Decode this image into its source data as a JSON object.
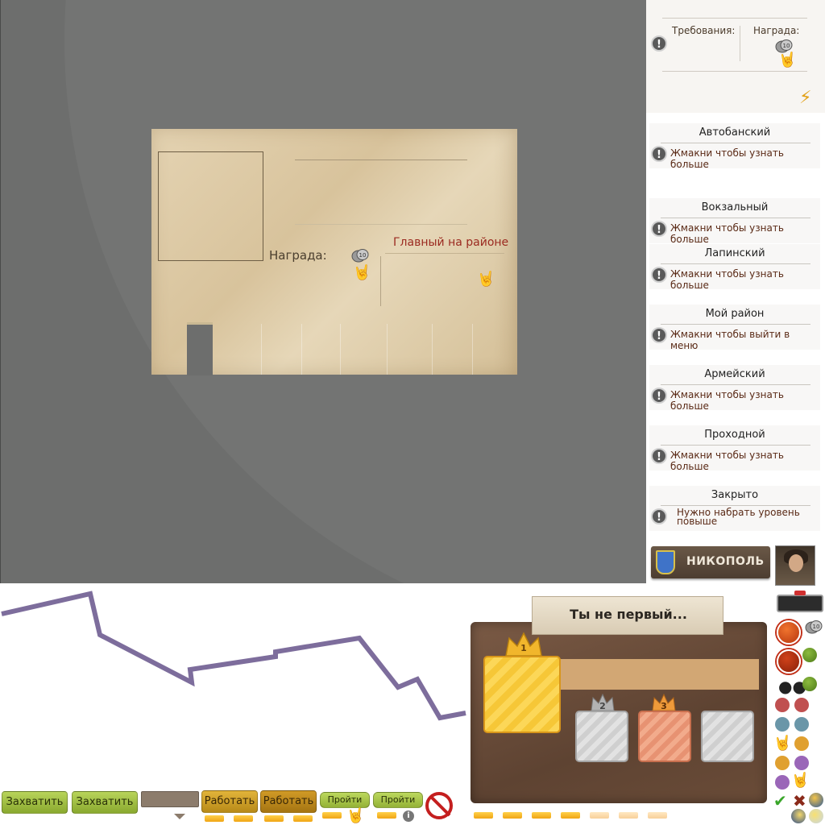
{
  "note": {
    "reward_label": "Награда:",
    "reward_title": "Главный на районе"
  },
  "requirements": {
    "requirements_label": "Требования:",
    "reward_label": "Награда:"
  },
  "districts": [
    {
      "name": "Автобанский",
      "desc": "Жмакни чтобы узнать больше"
    },
    {
      "name": "Вокзальный",
      "desc": "Жмакни чтобы узнать больше"
    },
    {
      "name": "Лапинский",
      "desc": "Жмакни чтобы узнать больше"
    },
    {
      "name": "Мой район",
      "desc": "Жмакни чтобы выйти в меню"
    },
    {
      "name": "Армейский",
      "desc": "Жмакни чтобы узнать больше"
    },
    {
      "name": "Проходной",
      "desc": "Жмакни чтобы узнать больше"
    },
    {
      "name": "Закрыто",
      "desc": "Нужно набрать уровень повыше"
    }
  ],
  "city": {
    "name": "НИКОПОЛЬ"
  },
  "podium": {
    "title": "Ты не первый...",
    "ranks": [
      "1",
      "2",
      "3"
    ]
  },
  "buttons": {
    "capture_1": "Захватить",
    "capture_2": "Захватить",
    "work_1": "Работать",
    "work_2": "Работать",
    "pass_1": "Пройти",
    "pass_2": "Пройти"
  },
  "colors": {
    "viewport_bg": "#6d6e6d",
    "accent_red": "#9b2a20",
    "graph_line": "#7d6d9c",
    "podium_brown": "#5e4332"
  },
  "icons": {
    "exclamation": "exclamation-icon",
    "bolt": "bolt-icon",
    "coin": "coin-icon",
    "hand": "rock-hand-icon"
  }
}
